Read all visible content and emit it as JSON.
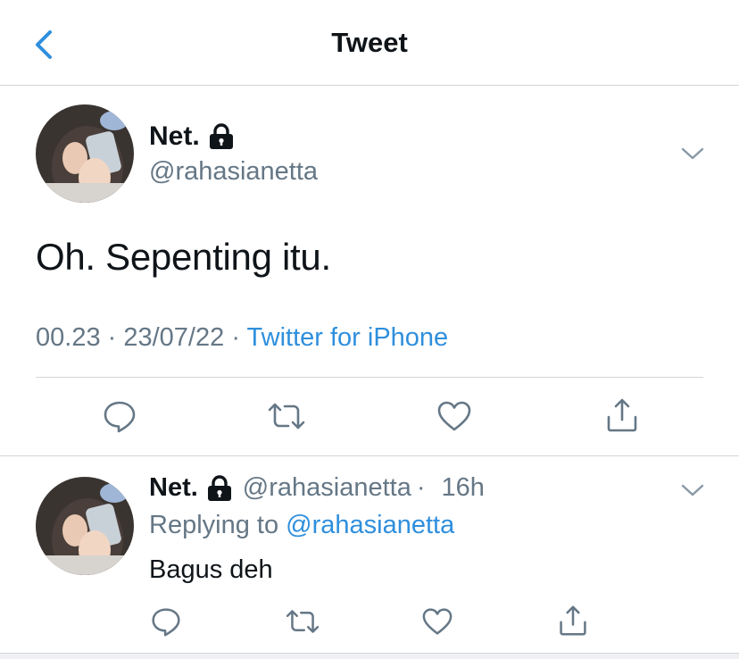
{
  "header": {
    "title": "Tweet",
    "back_icon": "chevron-left-icon"
  },
  "tweet": {
    "display_name": "Net.",
    "handle": "@rahasianetta",
    "protected_icon": "lock-icon",
    "text": "Oh. Sepenting itu.",
    "time": "00.23",
    "separator": "·",
    "date": "23/07/22",
    "source": "Twitter for iPhone",
    "menu_icon": "chevron-down-icon",
    "actions": [
      "reply-icon",
      "retweet-icon",
      "like-icon",
      "share-icon"
    ]
  },
  "reply": {
    "display_name": "Net.",
    "handle": "@rahasianetta",
    "separator": "·",
    "age": "16h",
    "replying_prefix": "Replying to ",
    "replying_to": "@rahasianetta",
    "text": "Bagus deh",
    "menu_icon": "chevron-down-icon",
    "actions": [
      "reply-icon",
      "retweet-icon",
      "like-icon",
      "share-icon"
    ]
  },
  "colors": {
    "accent": "#2f8fdd",
    "secondary_text": "#657786",
    "primary_text": "#0f1419",
    "divider": "#d3d6d9"
  }
}
